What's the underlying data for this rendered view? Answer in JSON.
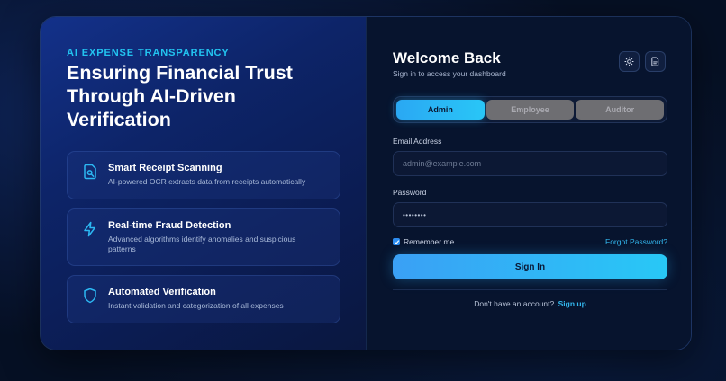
{
  "hero": {
    "eyebrow": "AI EXPENSE TRANSPARENCY",
    "headline": "Ensuring Financial Trust Through AI-Driven Verification"
  },
  "features": [
    {
      "icon": "receipt-scan-icon",
      "title": "Smart Receipt Scanning",
      "description": "AI-powered OCR extracts data from receipts automatically"
    },
    {
      "icon": "lightning-icon",
      "title": "Real-time Fraud Detection",
      "description": "Advanced algorithms identify anomalies and suspicious patterns"
    },
    {
      "icon": "shield-icon",
      "title": "Automated Verification",
      "description": "Instant validation and categorization of all expenses"
    }
  ],
  "login": {
    "title": "Welcome Back",
    "subtitle": "Sign in to access your dashboard",
    "roles": [
      "Admin",
      "Employee",
      "Auditor"
    ],
    "active_role": "Admin",
    "email_label": "Email Address",
    "email_placeholder": "admin@example.com",
    "password_label": "Password",
    "password_value": "••••••••",
    "remember_label": "Remember me",
    "remember_checked": true,
    "forgot_label": "Forgot Password?",
    "signin_label": "Sign In",
    "no_account_text": "Don't have an account?",
    "signup_label": "Sign up"
  },
  "header_icons": [
    "sun-icon",
    "document-icon"
  ],
  "colors": {
    "accent": "#29c6f7",
    "eyebrow": "#22c4f0",
    "panel_left": "#0d2468",
    "panel_right": "#07142e"
  }
}
